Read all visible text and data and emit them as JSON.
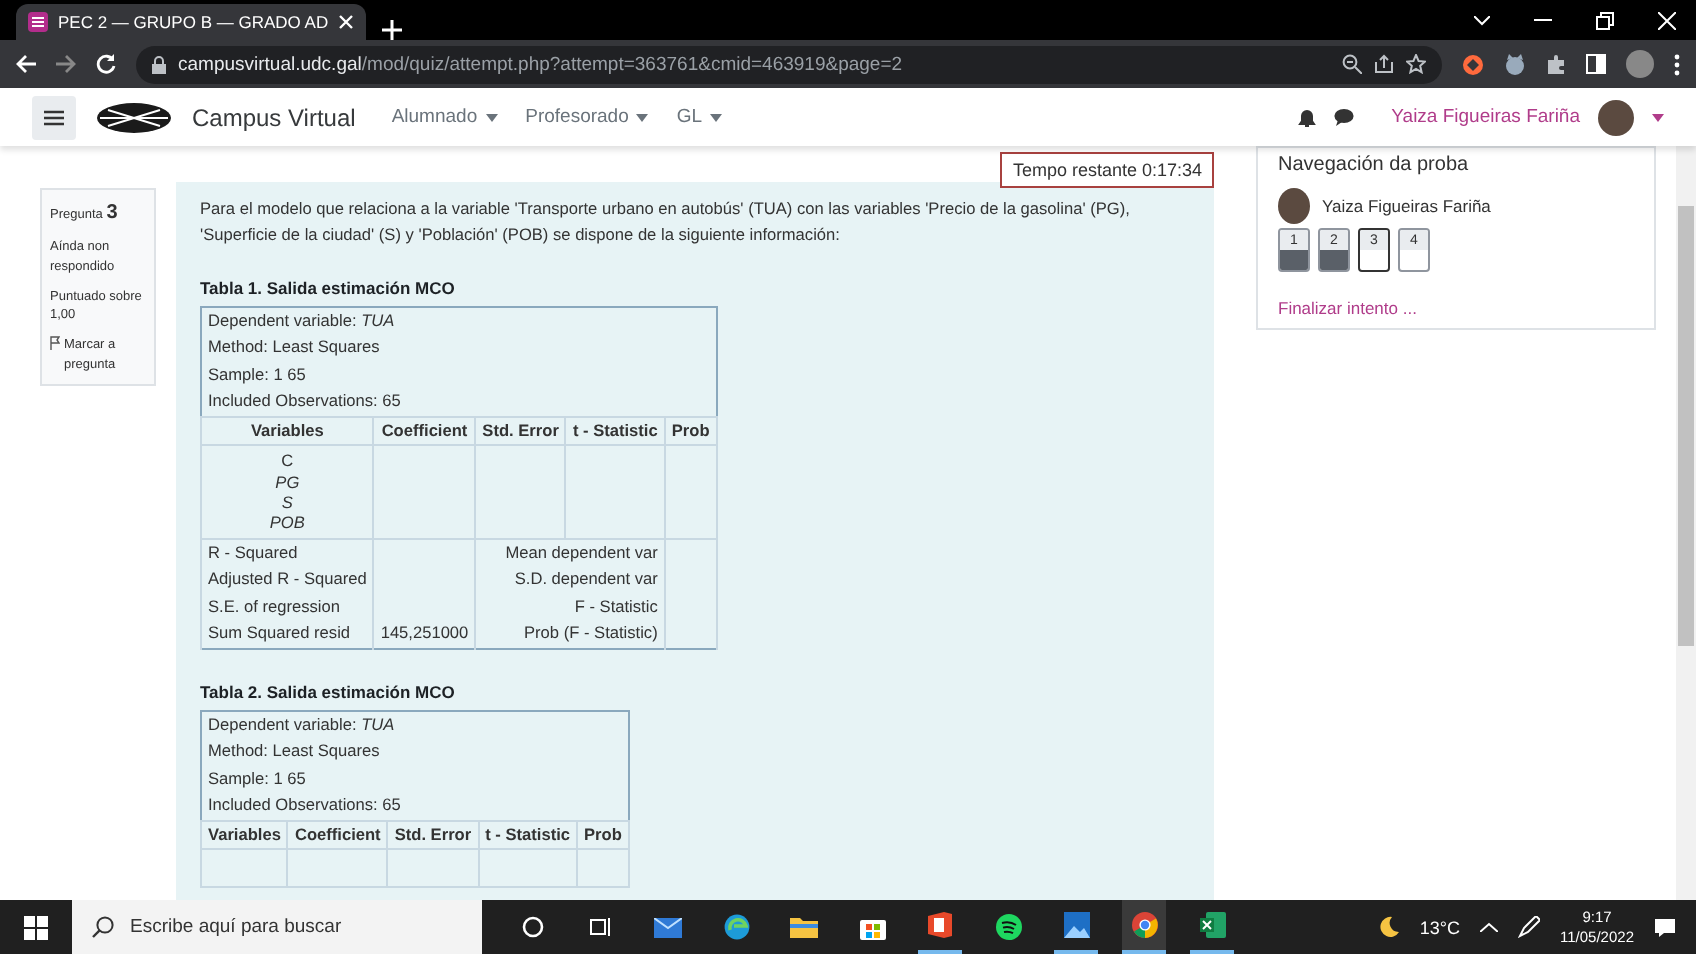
{
  "browser": {
    "tabs": [
      {
        "title": "PEC 2 — GRUPO B — GRADO AD",
        "selected": true
      }
    ],
    "url_host": "campusvirtual.udc.gal",
    "url_path": "/mod/quiz/attempt.php?attempt=363761&cmid=463919&page=2"
  },
  "navbar": {
    "brand": "Campus Virtual",
    "menus": [
      "Alumnado",
      "Profesorado",
      "GL"
    ],
    "user": "Yaiza Figueiras Fariña"
  },
  "timer": "Tempo restante 0:17:34",
  "question_info": {
    "label": "Pregunta",
    "number": "3",
    "status": "Aínda non respondido",
    "grade": "Puntuado sobre 1,00",
    "flag": "Marcar a pregunta"
  },
  "question_text": "Para el modelo que relaciona a la variable 'Transporte urbano en autobús' (TUA) con las variables 'Precio de la gasolina' (PG), 'Superficie de la ciudad' (S) y 'Población' (POB) se dispone de la siguiente información:",
  "tables": [
    {
      "caption": "Tabla 1. Salida estimación MCO",
      "info": [
        "Dependent variable: *TUA*",
        "Method: Least Squares",
        "Sample: 1 65",
        "Included Observations: 65"
      ],
      "columns": [
        "Variables",
        "Coefficient",
        "Std. Error",
        "t - Statistic",
        "Prob"
      ],
      "variables": [
        "C",
        "*PG*",
        "*S*",
        "*POB*"
      ],
      "stats": [
        {
          "label": "R - Squared",
          "right_label": "Mean dependent var"
        },
        {
          "label": "Adjusted R - Squared",
          "right_label": "S.D. dependent var"
        },
        {
          "label": "S.E. of regression",
          "right_label": "F - Statistic"
        },
        {
          "label": "Sum Squared resid",
          "value": "145,251000",
          "right_label": "Prob (F - Statistic)"
        }
      ]
    },
    {
      "caption": "Tabla 2. Salida estimación MCO",
      "info": [
        "Dependent variable: *TUA*",
        "Method: Least Squares",
        "Sample: 1 65",
        "Included Observations: 65"
      ],
      "columns": [
        "Variables",
        "Coefficient",
        "Std. Error",
        "t - Statistic",
        "Prob"
      ]
    }
  ],
  "quiz_navigation": {
    "title": "Navegación da proba",
    "user": "Yaiza Figueiras Fariña",
    "buttons": [
      {
        "label": "1",
        "answered": true,
        "selected": false
      },
      {
        "label": "2",
        "answered": true,
        "selected": false
      },
      {
        "label": "3",
        "answered": false,
        "selected": true
      },
      {
        "label": "4",
        "answered": false,
        "selected": false
      }
    ],
    "finish": "Finalizar intento ..."
  },
  "taskbar": {
    "search_placeholder": "Escribe aquí para buscar",
    "temperature": "13°C",
    "time": "9:17",
    "date": "11/05/2022"
  }
}
